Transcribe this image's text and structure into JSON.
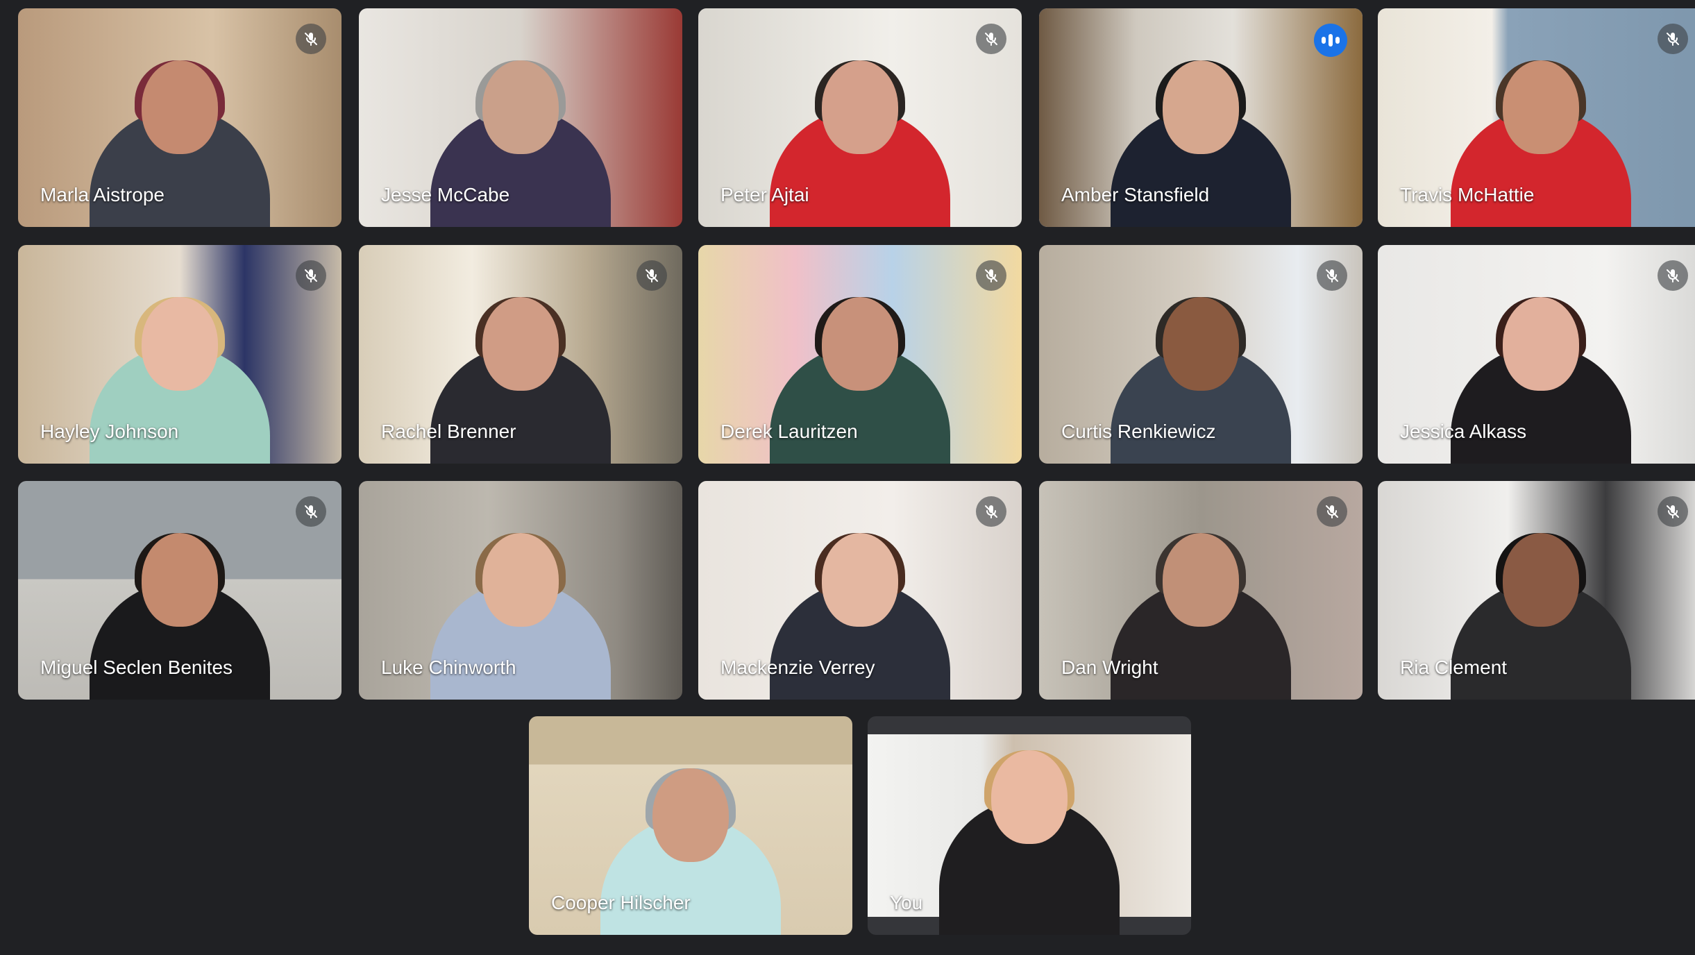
{
  "colors": {
    "background": "#202124",
    "speaking_outline": "#8ab4f8",
    "speaking_badge": "#1a73e8",
    "self_frame": "#35363a"
  },
  "participants": [
    {
      "name": "Marla Aistrope",
      "muted": true,
      "speaking": false
    },
    {
      "name": "Jesse McCabe",
      "muted": false,
      "speaking": false
    },
    {
      "name": "Peter Ajtai",
      "muted": true,
      "speaking": false
    },
    {
      "name": "Amber Stansfield",
      "muted": false,
      "speaking": true
    },
    {
      "name": "Travis McHattie",
      "muted": true,
      "speaking": false
    },
    {
      "name": "Hayley Johnson",
      "muted": true,
      "speaking": false
    },
    {
      "name": "Rachel Brenner",
      "muted": true,
      "speaking": false
    },
    {
      "name": "Derek Lauritzen",
      "muted": true,
      "speaking": false
    },
    {
      "name": "Curtis Renkiewicz",
      "muted": true,
      "speaking": false
    },
    {
      "name": "Jessica Alkass",
      "muted": true,
      "speaking": false
    },
    {
      "name": "Miguel Seclen Benites",
      "muted": true,
      "speaking": false
    },
    {
      "name": "Luke Chinworth",
      "muted": false,
      "speaking": false
    },
    {
      "name": "Mackenzie Verrey",
      "muted": true,
      "speaking": false
    },
    {
      "name": "Dan Wright",
      "muted": true,
      "speaking": false
    },
    {
      "name": "Ria Clement",
      "muted": true,
      "speaking": false
    },
    {
      "name": "Cooper Hilscher",
      "muted": false,
      "speaking": false
    },
    {
      "name": "You",
      "muted": false,
      "speaking": false
    }
  ],
  "icons": {
    "muted": "mic-off-icon",
    "speaking": "audio-level-icon"
  }
}
